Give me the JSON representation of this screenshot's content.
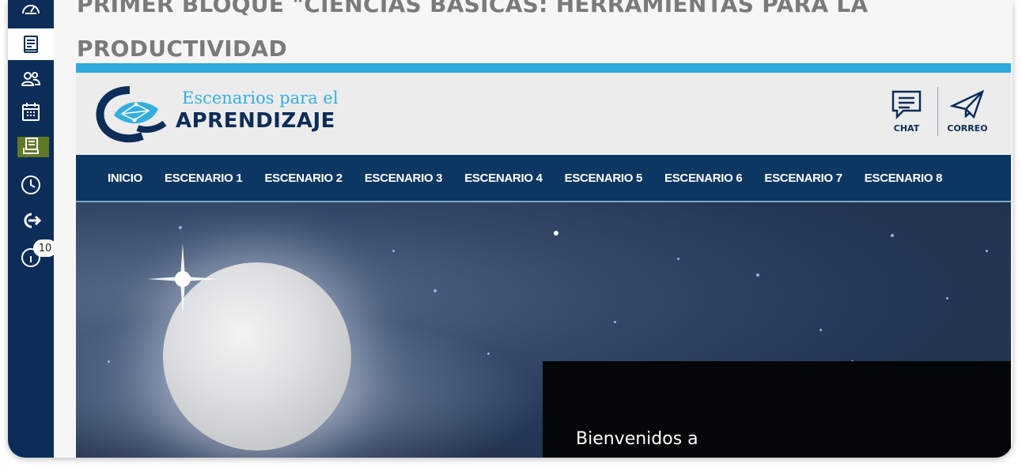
{
  "page": {
    "title": "PRIMER BLOQUE \"CIENCIAS BÁSICAS: HERRAMIENTAS PARA LA PRODUCTIVIDAD"
  },
  "sidebar": {
    "items": [
      {
        "icon": "speedometer-icon"
      },
      {
        "icon": "book-icon",
        "active": true
      },
      {
        "icon": "users-icon"
      },
      {
        "icon": "calendar-icon"
      },
      {
        "icon": "stack-icon",
        "highlighted": true
      },
      {
        "icon": "clock-icon"
      },
      {
        "icon": "exit-icon"
      },
      {
        "icon": "info-icon"
      }
    ],
    "badge": "10"
  },
  "site": {
    "logo_line1": "Escenarios para el",
    "logo_line2": "APRENDIZAJE",
    "chat_label": "CHAT",
    "mail_label": "CORREO",
    "nav": [
      "INICIO",
      "ESCENARIO 1",
      "ESCENARIO 2",
      "ESCENARIO 3",
      "ESCENARIO 4",
      "ESCENARIO 5",
      "ESCENARIO 6",
      "ESCENARIO 7",
      "ESCENARIO 8"
    ],
    "welcome": "Bienvenidos a"
  },
  "colors": {
    "sidebar": "#0c2d58",
    "accent_bar": "#2fa8db",
    "nav": "#0c3763",
    "logo_text_light": "#35aedd",
    "logo_text_dark": "#0c2d58"
  }
}
